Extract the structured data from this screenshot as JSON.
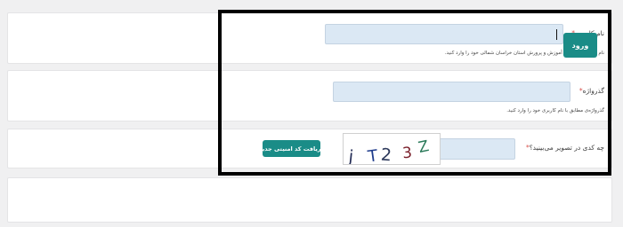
{
  "username": {
    "label": "نام کاربری",
    "required_mark": "*",
    "value": "",
    "hint": "نام کاربری اداره کل آموزش و پرورش استان خراسان شمالی خود را وارد کنید."
  },
  "password": {
    "label": "گذرواژه",
    "required_mark": "*",
    "value": "",
    "hint": "گذرواژه‌ی مطابق با نام کاربری خود را وارد کنید."
  },
  "captcha": {
    "label": "چه کدی در تصویر می‌بینید؟",
    "required_mark": "*",
    "value": "",
    "image_text": [
      "j",
      "T",
      "2",
      "3",
      "Z"
    ],
    "refresh_label": "دریافت کد امنیتی جدید"
  },
  "submit": {
    "label": "ورود"
  },
  "colors": {
    "accent": "#1a8c87",
    "input_bg": "#dbe8f4",
    "required": "#d9534f",
    "highlight": "#000000"
  }
}
